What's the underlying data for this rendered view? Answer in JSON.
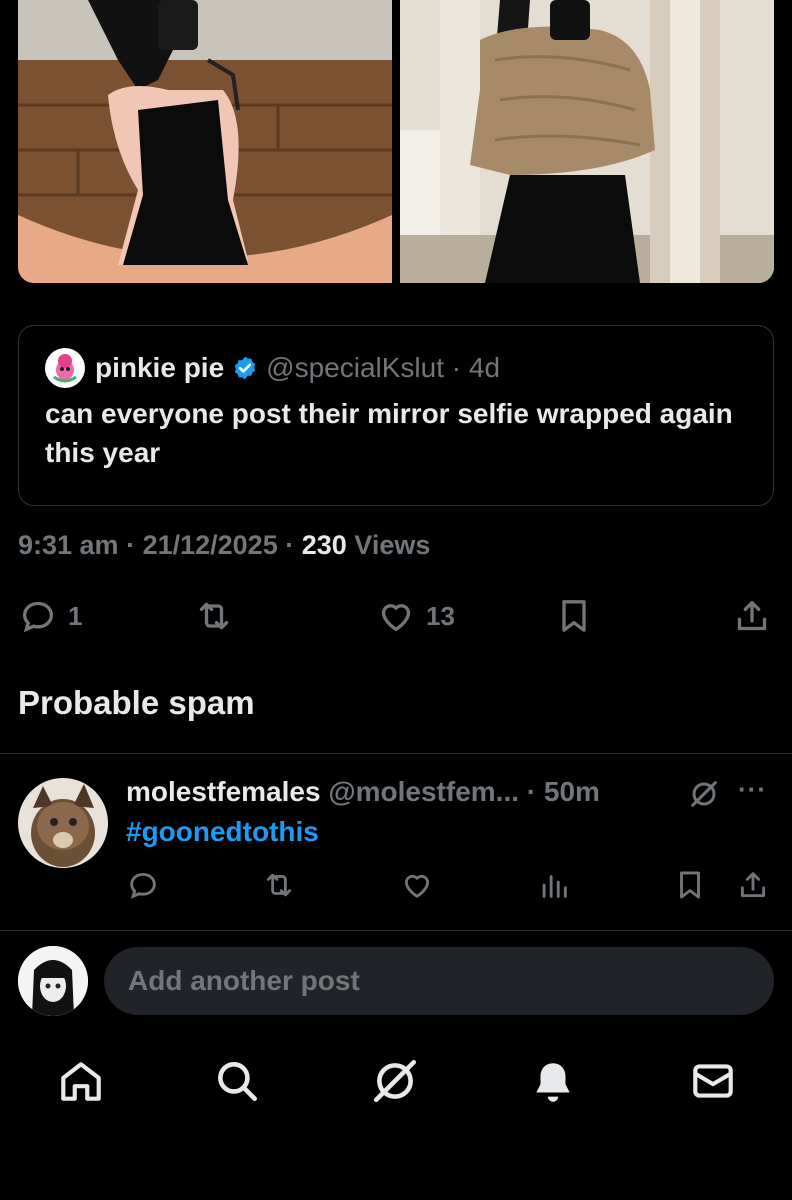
{
  "quoted_post": {
    "display_name": "pinkie pie",
    "handle": "@specialKslut",
    "age": "4d",
    "text": "can everyone post their mirror selfie wrapped again this year"
  },
  "post_meta": {
    "time": "9:31 am",
    "date": "21/12/2025",
    "views_count": "230",
    "views_label": "Views"
  },
  "actions": {
    "reply_count": "1",
    "like_count": "13"
  },
  "section_title": "Probable spam",
  "reply": {
    "display_name": "molestfemales",
    "handle": "@molestfem...",
    "age": "50m",
    "text": "#goonedtothis",
    "more": "···"
  },
  "compose": {
    "placeholder": "Add another post"
  },
  "icons": {
    "reply": "reply-icon",
    "repost": "repost-icon",
    "like": "heart-icon",
    "bookmark": "bookmark-icon",
    "share": "share-icon",
    "views": "views-icon",
    "grok": "grok-icon",
    "verified": "verified-badge-icon",
    "home": "home-icon",
    "search": "search-icon",
    "notifications": "bell-icon",
    "messages": "mail-icon"
  },
  "colors": {
    "background": "#000000",
    "text": "#e7e9ea",
    "muted": "#71767b",
    "link": "#1d9bf0",
    "border": "#2f3336"
  }
}
